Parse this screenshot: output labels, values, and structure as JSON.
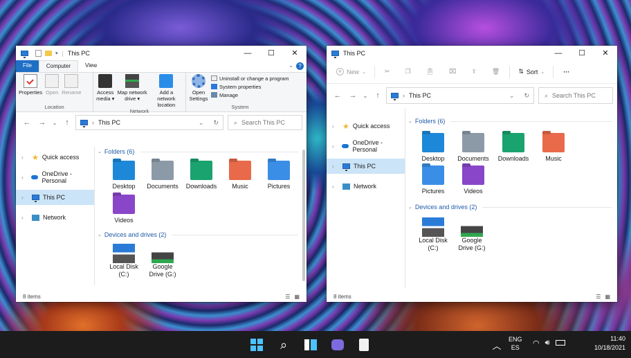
{
  "left_window": {
    "title": "This PC",
    "ribbon_tabs": [
      "File",
      "Computer",
      "View"
    ],
    "groups": [
      {
        "label": "Location",
        "buttons": [
          "Properties",
          "Open",
          "Rename"
        ]
      },
      {
        "label": "Network",
        "buttons": [
          "Access media ▾",
          "Map network drive ▾",
          "Add a network location"
        ]
      },
      {
        "label": "System",
        "buttons": [
          "Open Settings"
        ],
        "small_items": [
          "Uninstall or change a program",
          "System properties",
          "Manage"
        ]
      }
    ],
    "address": "This PC",
    "search_placeholder": "Search This PC",
    "status": "8 items"
  },
  "right_window": {
    "title": "This PC",
    "commands": {
      "new": "New",
      "sort": "Sort",
      "more": "···"
    },
    "address": "This PC",
    "search_placeholder": "Search This PC",
    "status": "8 items"
  },
  "nav_items": [
    "Quick access",
    "OneDrive - Personal",
    "This PC",
    "Network"
  ],
  "folders_header": "Folders (6)",
  "folders": [
    {
      "name": "Desktop",
      "color": "#1e88d8"
    },
    {
      "name": "Documents",
      "color": "#8c9aa8"
    },
    {
      "name": "Downloads",
      "color": "#1aa36f"
    },
    {
      "name": "Music",
      "color": "#e86a4a"
    },
    {
      "name": "Pictures",
      "color": "#3a8ee6"
    },
    {
      "name": "Videos",
      "color": "#8a46c8"
    }
  ],
  "devices_header": "Devices and drives (2)",
  "drives": [
    {
      "name_line1": "Local Disk",
      "name_line2": "(C:)"
    },
    {
      "name_line1": "Google",
      "name_line2": "Drive (G:)"
    }
  ],
  "taskbar": {
    "lang1": "ENG",
    "lang2": "ES",
    "time": "11:40",
    "date": "10/18/2021"
  }
}
